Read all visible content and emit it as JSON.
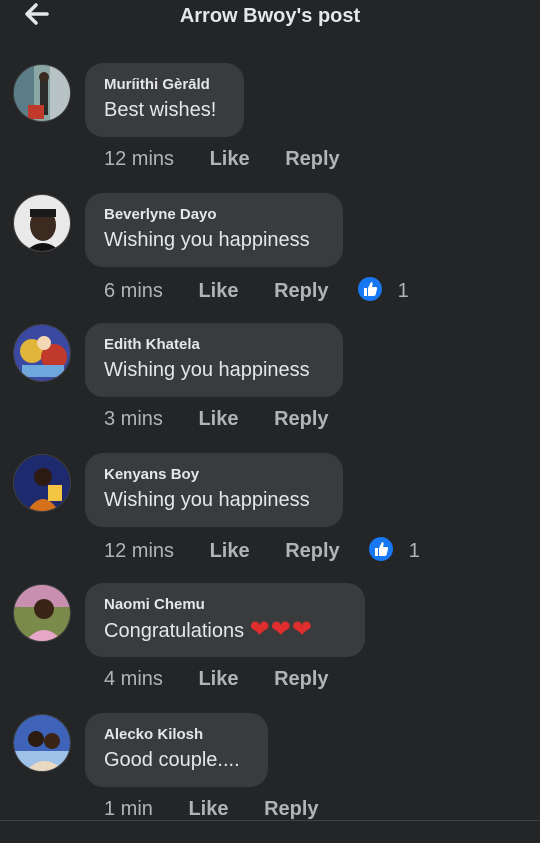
{
  "header": {
    "title": "Arrow Bwoy's post",
    "back_icon": "arrow-left-icon"
  },
  "colors": {
    "background": "#242526",
    "bubble": "#3a3b3c",
    "reaction_like": "#1877f2",
    "heart": "#e02e2e"
  },
  "comments": [
    {
      "name": "Muríithi Gèrāld",
      "text": "Best wishes!",
      "time": "12 mins",
      "like": "Like",
      "reply": "Reply",
      "reactions": ""
    },
    {
      "name": "Beverlyne Dayo",
      "text": "Wishing you happiness",
      "time": "6 mins",
      "like": "Like",
      "reply": "Reply",
      "reactions": "1"
    },
    {
      "name": "Edith Khatela",
      "text": "Wishing you happiness",
      "time": "3 mins",
      "like": "Like",
      "reply": "Reply",
      "reactions": ""
    },
    {
      "name": "Kenyans Boy",
      "text": "Wishing you happiness",
      "time": "12 mins",
      "like": "Like",
      "reply": "Reply",
      "reactions": "1"
    },
    {
      "name": "Naomi Chemu",
      "text": "Congratulations",
      "hearts": "❤❤❤",
      "time": "4 mins",
      "like": "Like",
      "reply": "Reply",
      "reactions": ""
    },
    {
      "name": "Alecko Kilosh",
      "text": "Good couple....",
      "time": "1 min",
      "like": "Like",
      "reply": "Reply",
      "reactions": ""
    }
  ]
}
